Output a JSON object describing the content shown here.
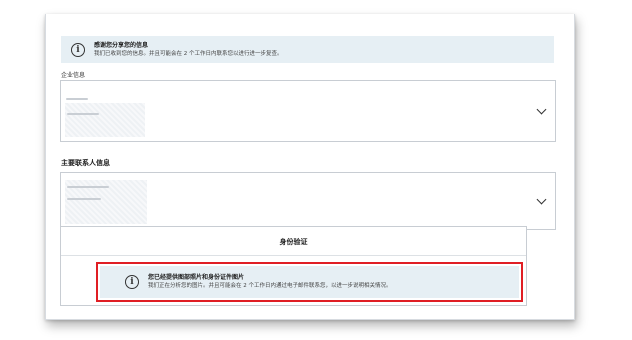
{
  "top_notice": {
    "icon": "info-icon",
    "title": "感谢您分享您的信息",
    "body": "我们已收到您的信息。并且可能会在 2 个工作日内联系您以进行进一步复查。"
  },
  "company_section": {
    "label": "企业信息"
  },
  "contact_section": {
    "heading": "主要联系人信息"
  },
  "identity_section": {
    "heading": "身份验证",
    "notice": {
      "icon": "info-icon",
      "title": "您已经提供图部照片和身份证件图片",
      "body": "我们正在分析您的图片。并且可能会在 2 个工作日内通过电子邮件联系您，以进一步说明相关情况。"
    }
  },
  "colors": {
    "highlight": "#e01e24",
    "notice_bg": "#e6eff4"
  }
}
